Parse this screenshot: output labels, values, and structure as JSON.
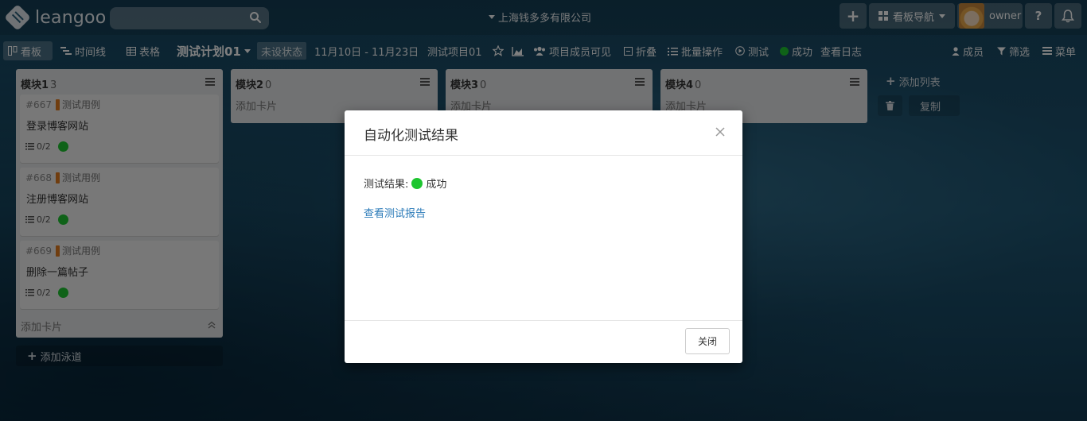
{
  "topbar": {
    "logo_text": "leangoo",
    "search": {
      "value": "",
      "placeholder": ""
    },
    "org_name": "上海钱多多有限公司",
    "board_nav_label": "看板导航",
    "user_name": "owner",
    "help_label": "?"
  },
  "toolbar": {
    "board_label": "看板",
    "timeline_label": "时间线",
    "table_label": "表格",
    "plan_name": "测试计划01",
    "status_label": "未设状态",
    "date_range": "11月10日 - 11月23日",
    "project_name": "测试项目01",
    "visibility_label": "项目成员可见",
    "fold_label": "折叠",
    "batch_label": "批量操作",
    "test_label": "测试",
    "success_label": "成功",
    "log_label": "查看日志",
    "members_label": "成员",
    "filter_label": "筛选",
    "menu_label": "菜单"
  },
  "lists": [
    {
      "title": "模块1",
      "count": "3",
      "cards": [
        {
          "id": "#667",
          "tag": "测试用例",
          "title": "登录博客网站",
          "checklist": "0/2"
        },
        {
          "id": "#668",
          "tag": "测试用例",
          "title": "注册博客网站",
          "checklist": "0/2"
        },
        {
          "id": "#669",
          "tag": "测试用例",
          "title": "删除一篇帖子",
          "checklist": "0/2"
        }
      ],
      "add_card_label": "添加卡片"
    },
    {
      "title": "模块2",
      "count": "0",
      "cards": [],
      "add_card_label": "添加卡片"
    },
    {
      "title": "模块3",
      "count": "0",
      "cards": [],
      "add_card_label": "添加卡片"
    },
    {
      "title": "模块4",
      "count": "0",
      "cards": [],
      "add_card_label": "添加卡片"
    }
  ],
  "add_lane_label": "添加泳道",
  "add_list_label": "添加列表",
  "copy_label": "复制",
  "modal": {
    "title": "自动化测试结果",
    "result_label": "测试结果:",
    "result_value": "成功",
    "report_link": "查看测试报告",
    "close_button": "关闭"
  },
  "colors": {
    "success": "#1ec530",
    "tag": "#e07a1f",
    "link": "#2a7ab8"
  }
}
